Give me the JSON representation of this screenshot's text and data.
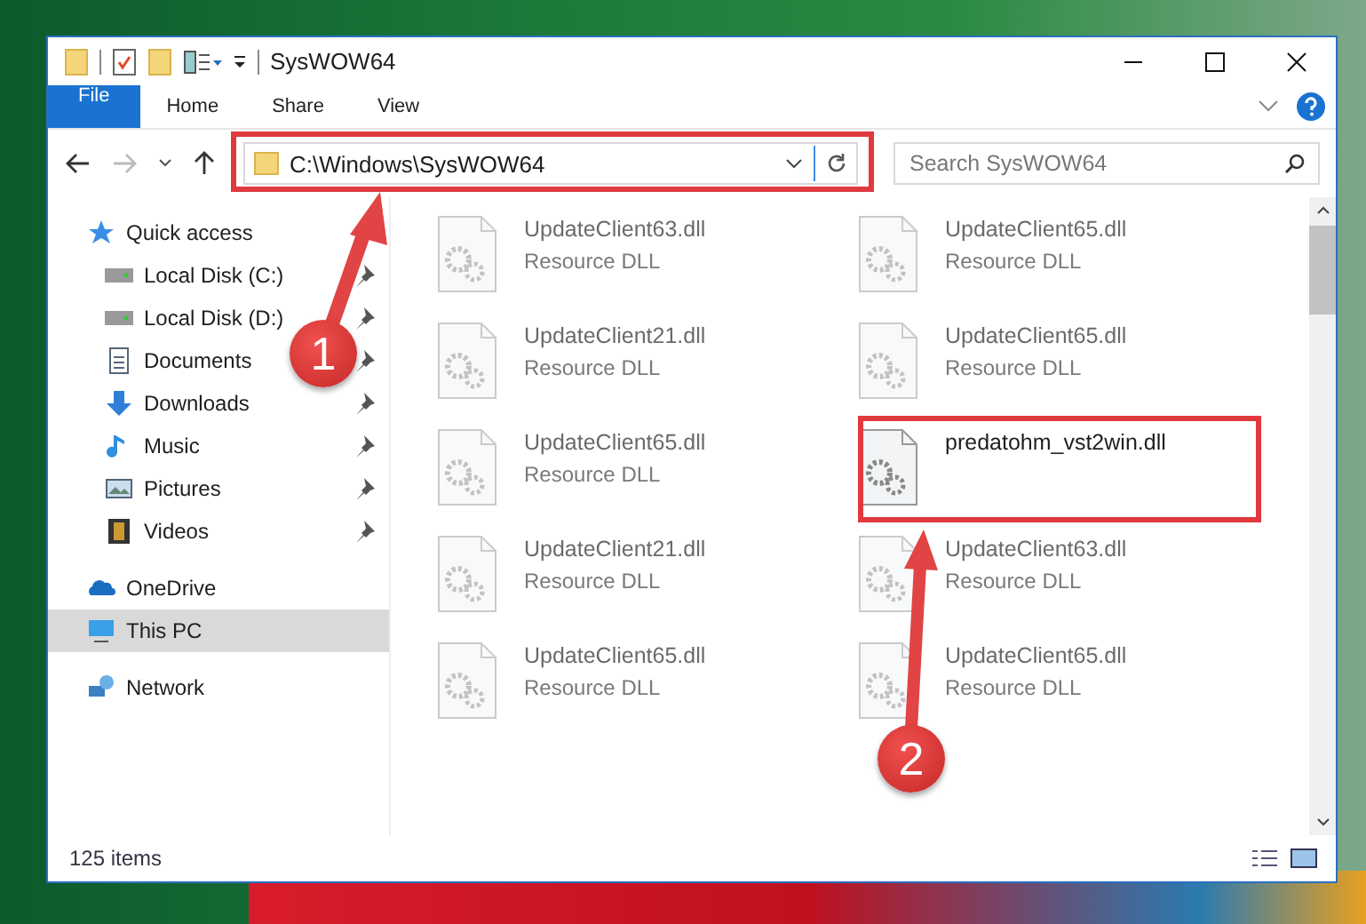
{
  "window": {
    "title": "SysWOW64"
  },
  "ribbon_tabs": [
    {
      "label": "File",
      "kind": "file"
    },
    {
      "label": "Home",
      "kind": "tab"
    },
    {
      "label": "Share",
      "kind": "tab"
    },
    {
      "label": "View",
      "kind": "tab"
    }
  ],
  "address_bar": {
    "path": "C:\\Windows\\SysWOW64"
  },
  "search": {
    "placeholder": "Search SysWOW64"
  },
  "navigation": [
    {
      "label": "Quick access",
      "kind": "star",
      "selected": false,
      "children": [
        {
          "label": "Local Disk (C:)",
          "kind": "drive",
          "pinned": true,
          "selected": false
        },
        {
          "label": "Local Disk (D:)",
          "kind": "drive",
          "pinned": true,
          "selected": false
        },
        {
          "label": "Documents",
          "kind": "document",
          "pinned": true,
          "selected": false
        },
        {
          "label": "Downloads",
          "kind": "download",
          "pinned": true,
          "selected": false
        },
        {
          "label": "Music",
          "kind": "music",
          "pinned": true,
          "selected": false
        },
        {
          "label": "Pictures",
          "kind": "picture",
          "pinned": true,
          "selected": false
        },
        {
          "label": "Videos",
          "kind": "video",
          "pinned": true,
          "selected": false
        }
      ]
    },
    {
      "label": "OneDrive",
      "kind": "cloud",
      "selected": false
    },
    {
      "label": "This PC",
      "kind": "computer",
      "selected": true
    },
    {
      "label": "Network",
      "kind": "network",
      "selected": false
    }
  ],
  "files": [
    {
      "name": "UpdateClient63.dll",
      "type": "Resource DLL",
      "blurred": true
    },
    {
      "name": "UpdateClient65.dll",
      "type": "Resource DLL",
      "blurred": true
    },
    {
      "name": "UpdateClient21.dll",
      "type": "Resource DLL",
      "blurred": true
    },
    {
      "name": "UpdateClient65.dll",
      "type": "Resource DLL",
      "blurred": true
    },
    {
      "name": "UpdateClient65.dll",
      "type": "Resource DLL",
      "blurred": true
    },
    {
      "name": "predatohm_vst2win.dll",
      "blurred": false
    },
    {
      "name": "UpdateClient21.dll",
      "type": "Resource DLL",
      "blurred": true
    },
    {
      "name": "UpdateClient63.dll",
      "type": "Resource DLL",
      "blurred": true
    },
    {
      "name": "UpdateClient65.dll",
      "type": "Resource DLL",
      "blurred": true
    },
    {
      "name": "UpdateClient65.dll",
      "type": "Resource DLL",
      "blurred": true
    }
  ],
  "status_bar": {
    "item_count": "125 items"
  },
  "annotations": [
    {
      "label": "1"
    },
    {
      "label": "2"
    }
  ]
}
